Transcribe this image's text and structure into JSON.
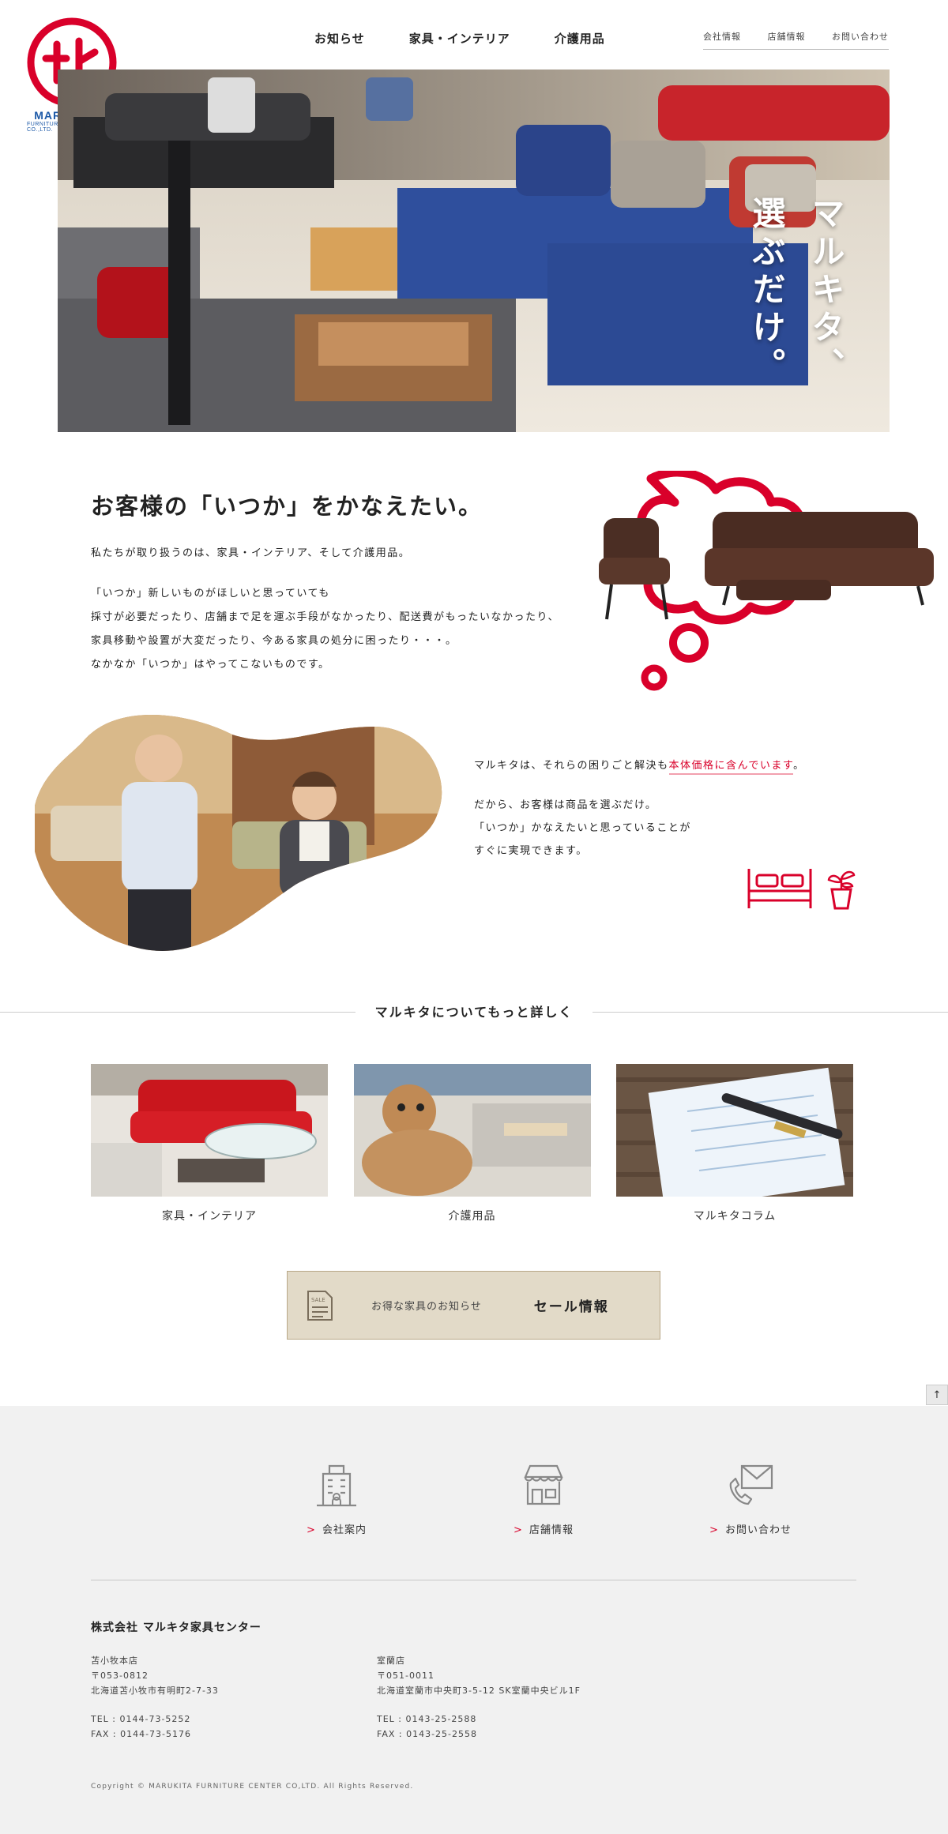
{
  "logo": {
    "name": "MARUKITA",
    "sub": "FURNITURE CENTER CO.,LTD."
  },
  "nav": {
    "main": [
      "お知らせ",
      "家具・インテリア",
      "介護用品"
    ],
    "sub": [
      "会社情報",
      "店舗情報",
      "お問い合わせ"
    ]
  },
  "hero": {
    "copy_line1": "マルキタ、",
    "copy_line2": "選ぶだけ。"
  },
  "intro": {
    "title": "お客様の「いつか」をかなえたい。",
    "p1": "私たちが取り扱うのは、家具・インテリア、そして介護用品。",
    "p2": [
      "「いつか」新しいものがほしいと思っていても",
      "採寸が必要だったり、店舗まで足を運ぶ手段がなかったり、配送費がもったいなかったり、",
      "家具移動や設置が大変だったり、今ある家具の処分に困ったり・・・。",
      "なかなか「いつか」はやってこないものです。"
    ]
  },
  "value": {
    "line1_prefix": "マルキタは、それらの困りごと解決も",
    "line1_highlight": "本体価格に含んでいます",
    "line1_suffix": "。",
    "p2": [
      "だから、お客様は商品を選ぶだけ。",
      "「いつか」かなえたいと思っていることが",
      "すぐに実現できます。"
    ]
  },
  "more": {
    "title": "マルキタについてもっと詳しく",
    "cards": [
      {
        "label": "家具・インテリア"
      },
      {
        "label": "介護用品"
      },
      {
        "label": "マルキタコラム"
      }
    ]
  },
  "sale": {
    "icon_text": "SALE",
    "sub": "お得な家具のお知らせ",
    "main": "セール情報"
  },
  "pagetop": "↑",
  "footer": {
    "links": [
      {
        "label": "会社案内",
        "icon": "building-icon"
      },
      {
        "label": "店舗情報",
        "icon": "store-icon"
      },
      {
        "label": "お問い合わせ",
        "icon": "mail-phone-icon"
      }
    ],
    "arrow": ">",
    "company": "株式会社 マルキタ家具センター",
    "branches": [
      {
        "name": "苫小牧本店",
        "zip": "〒053-0812",
        "address": "北海道苫小牧市有明町2-7-33",
        "tel": "TEL : 0144-73-5252",
        "fax": "FAX : 0144-73-5176"
      },
      {
        "name": "室蘭店",
        "zip": "〒051-0011",
        "address": "北海道室蘭市中央町3-5-12 SK室蘭中央ビル1F",
        "tel": "TEL : 0143-25-2588",
        "fax": "FAX : 0143-25-2558"
      }
    ],
    "copyright": "Copyright © MARUKITA FURNITURE CENTER CO,LTD. All Rights Reserved."
  },
  "colors": {
    "brand_red": "#d9002a",
    "logo_blue": "#1e5aa8",
    "footer_bg": "#f1f1f1",
    "sale_bg": "#e2dac8"
  }
}
